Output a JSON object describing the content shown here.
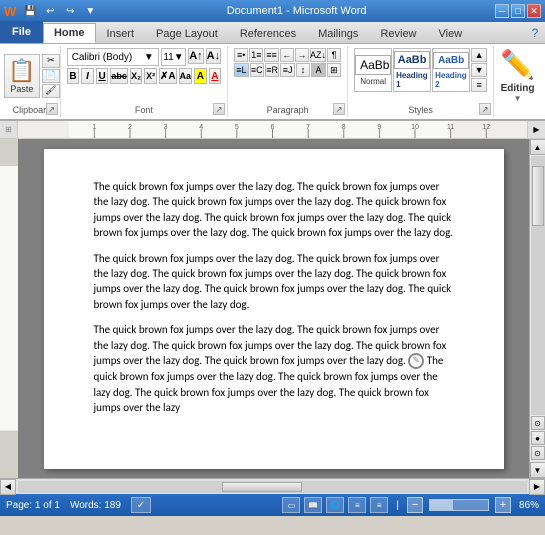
{
  "titlebar": {
    "title": "Document1  -  Microsoft Word",
    "quickaccess": [
      "save",
      "undo",
      "redo",
      "customize"
    ],
    "controls": [
      "minimize",
      "maximize",
      "close"
    ]
  },
  "tabs": [
    {
      "label": "File",
      "active": false,
      "is_file": true
    },
    {
      "label": "Home",
      "active": true
    },
    {
      "label": "Insert",
      "active": false
    },
    {
      "label": "Page Layout",
      "active": false
    },
    {
      "label": "References",
      "active": false
    },
    {
      "label": "Mailings",
      "active": false
    },
    {
      "label": "Review",
      "active": false
    },
    {
      "label": "View",
      "active": false
    }
  ],
  "ribbon": {
    "clipboard": {
      "label": "Clipboard",
      "paste_label": "Paste"
    },
    "font": {
      "label": "Font",
      "font_name": "Calibri (Body)",
      "font_size": "11",
      "bold": "B",
      "italic": "I",
      "underline": "U",
      "strikethrough": "abc",
      "subscript": "X₂",
      "superscript": "X²",
      "clear_format": "A",
      "grow": "A",
      "shrink": "A",
      "change_case": "Aa",
      "highlight": "A",
      "font_color": "A"
    },
    "paragraph": {
      "label": "Paragraph"
    },
    "styles": {
      "label": "Styles",
      "normal": "Normal",
      "heading1": "Heading 1",
      "heading2": "Heading 2"
    },
    "editing": {
      "label": "Editing"
    }
  },
  "document": {
    "paragraphs": [
      "The quick brown fox jumps over the lazy dog. The quick brown fox jumps over the lazy dog. The quick brown fox jumps over the lazy dog. The quick brown fox jumps over the lazy dog. The quick brown fox jumps over the lazy dog. The quick brown fox jumps over the lazy dog. The quick brown fox jumps over the lazy dog.",
      "The quick brown fox jumps over the lazy dog. The quick brown fox jumps over the lazy dog. The quick brown fox jumps over the lazy dog. The quick brown fox jumps over the lazy dog. The quick brown fox jumps over the lazy dog. The quick brown fox jumps over the lazy dog.",
      "The quick brown fox jumps over the lazy dog. The quick brown fox jumps over the lazy dog. The quick brown fox jumps over the lazy dog. The quick brown fox jumps over the lazy dog. The quick brown fox jumps over the lazy dog. The quick brown fox jumps over the lazy dog."
    ]
  },
  "statusbar": {
    "page_info": "Page: 1 of 1",
    "word_count": "Words: 189",
    "zoom_level": "86%"
  }
}
